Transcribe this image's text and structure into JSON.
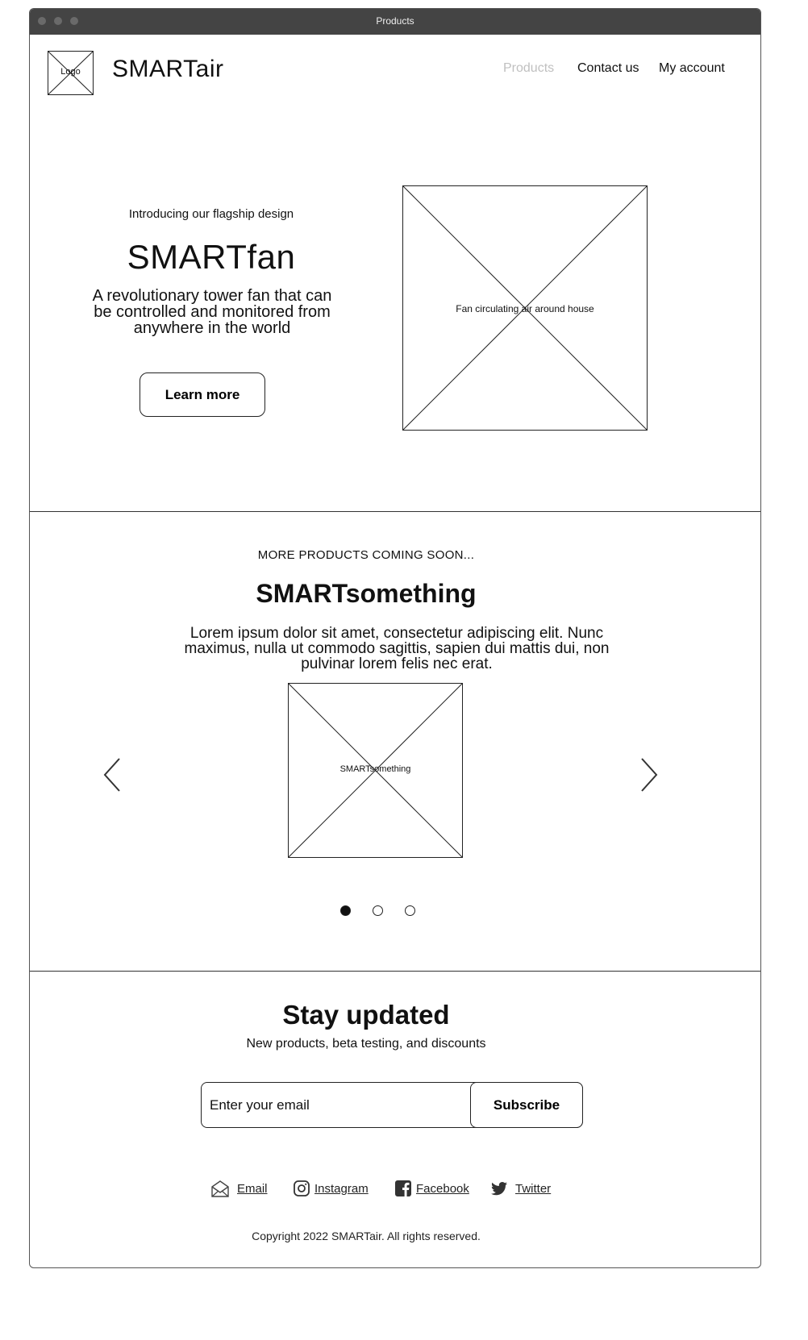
{
  "window": {
    "title": "Products"
  },
  "header": {
    "logo_label": "Logo",
    "brand": "SMARTair",
    "nav": [
      {
        "label": "Products",
        "active": true
      },
      {
        "label": "Contact us",
        "active": false
      },
      {
        "label": "My account",
        "active": false
      }
    ]
  },
  "hero": {
    "eyebrow": "Introducing our flagship design",
    "title": "SMARTfan",
    "description": "A revolutionary tower fan that can be controlled and monitored from anywhere in the world",
    "cta_label": "Learn more",
    "image_label": "Fan circulating air around house"
  },
  "coming_soon": {
    "eyebrow": "MORE PRODUCTS COMING SOON...",
    "title": "SMARTsomething",
    "description": "Lorem ipsum dolor sit amet, consectetur adipiscing elit. Nunc maximus, nulla ut commodo sagittis, sapien dui mattis dui, non pulvinar lorem felis nec erat.",
    "image_label": "SMARTsomething",
    "prev_icon": "chevron-left-icon",
    "next_icon": "chevron-right-icon",
    "carousel": {
      "slide_count": 3,
      "active_index": 0
    }
  },
  "newsletter": {
    "title": "Stay updated",
    "subtitle": "New products, beta testing, and discounts",
    "email_placeholder": "Enter your email",
    "subscribe_label": "Subscribe"
  },
  "social": [
    {
      "icon": "envelope-icon",
      "label": "Email"
    },
    {
      "icon": "instagram-icon",
      "label": "Instagram"
    },
    {
      "icon": "facebook-icon",
      "label": "Facebook"
    },
    {
      "icon": "twitter-icon",
      "label": "Twitter"
    }
  ],
  "footer": {
    "copyright": "Copyright 2022 SMARTair. All rights reserved."
  },
  "colors": {
    "nav_active": "#c0c0c0",
    "titlebar": "#444444",
    "border": "#222222"
  }
}
